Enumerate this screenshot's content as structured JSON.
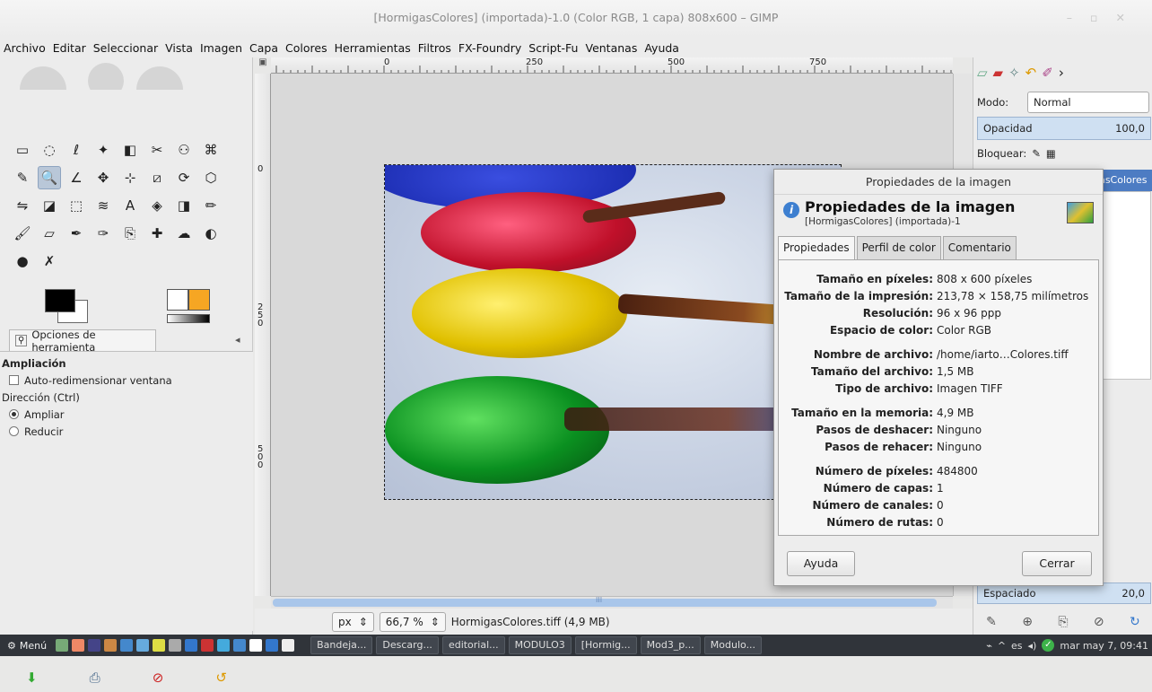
{
  "window": {
    "title": "[HormigasColores] (importada)-1.0 (Color RGB, 1 capa) 808x600 – GIMP"
  },
  "menubar": [
    "Archivo",
    "Editar",
    "Seleccionar",
    "Vista",
    "Imagen",
    "Capa",
    "Colores",
    "Herramientas",
    "Filtros",
    "FX-Foundry",
    "Script-Fu",
    "Ventanas",
    "Ayuda"
  ],
  "toolbox": {
    "tools": [
      "rect-select-icon",
      "ellipse-select-icon",
      "free-select-icon",
      "fuzzy-select-icon",
      "color-select-icon",
      "scissors-icon",
      "foreground-select-icon",
      "paths-icon",
      "color-picker-icon",
      "zoom-icon",
      "measure-icon",
      "move-icon",
      "align-icon",
      "crop-icon",
      "transform-icon",
      "cage-icon",
      "flip-icon",
      "perspective-icon",
      "unified-transform-icon",
      "warp-icon",
      "text-icon",
      "bucket-fill-icon",
      "blend-icon",
      "pencil-icon",
      "paintbrush-icon",
      "eraser-icon",
      "airbrush-icon",
      "ink-icon",
      "clone-icon",
      "heal-icon",
      "smudge-icon",
      "dodge-icon",
      "blur-icon",
      "pen-icon"
    ],
    "tool_glyphs": [
      "▭",
      "◌",
      "ℓ",
      "✦",
      "◧",
      "✂",
      "⚇",
      "⌘",
      "✎",
      "🔍",
      "∠",
      "✥",
      "⊹",
      "⧄",
      "⟳",
      "⬡",
      "⇋",
      "◪",
      "⬚",
      "≋",
      "A",
      "◈",
      "◨",
      "✏",
      "🖌",
      "▱",
      "✒",
      "✑",
      "⎘",
      "✚",
      "☁",
      "◐",
      "●",
      "✗"
    ],
    "options_tab": "Opciones de herramienta",
    "section_title": "Ampliación",
    "auto_resize": "Auto-redimensionar ventana",
    "direction_label": "Dirección (Ctrl)",
    "zoom_in": "Ampliar",
    "zoom_out": "Reducir"
  },
  "canvas": {
    "hruler_labels": [
      "0",
      "250",
      "500",
      "750"
    ],
    "vruler_labels": [
      "0",
      "250",
      "500"
    ],
    "unit": "px",
    "zoom": "66,7 %",
    "status": "HormigasColores.tiff (4,9 MB)",
    "scroll_mark": "III"
  },
  "dock": {
    "mode_label": "Modo:",
    "mode_value": "Normal",
    "opacity_label": "Opacidad",
    "opacity_value": "100,0",
    "lock_label": "Bloquear:",
    "layer_name": "HormigasColores",
    "spacing_label": "Espaciado",
    "spacing_value": "20,0"
  },
  "dialog": {
    "title": "Propiedades de la imagen",
    "heading": "Propiedades de la imagen",
    "subheading": "[HormigasColores] (importada)-1",
    "tabs": [
      "Propiedades",
      "Perfil de color",
      "Comentario"
    ],
    "props": [
      {
        "k": "Tamaño en píxeles:",
        "v": "808 x 600 píxeles"
      },
      {
        "k": "Tamaño de la impresión:",
        "v": "213,78 × 158,75 milímetros"
      },
      {
        "k": "Resolución:",
        "v": "96 x 96 ppp"
      },
      {
        "k": "Espacio de color:",
        "v": "Color RGB"
      },
      {
        "k": "Nombre de archivo:",
        "v": "/home/iarto…Colores.tiff"
      },
      {
        "k": "Tamaño del archivo:",
        "v": "1,5 MB"
      },
      {
        "k": "Tipo de archivo:",
        "v": "Imagen TIFF"
      },
      {
        "k": "Tamaño en la memoria:",
        "v": "4,9 MB"
      },
      {
        "k": "Pasos de deshacer:",
        "v": "Ninguno"
      },
      {
        "k": "Pasos de rehacer:",
        "v": "Ninguno"
      },
      {
        "k": "Número de píxeles:",
        "v": "484800"
      },
      {
        "k": "Número de capas:",
        "v": "1"
      },
      {
        "k": "Número de canales:",
        "v": "0"
      },
      {
        "k": "Número de rutas:",
        "v": "0"
      }
    ],
    "help_button": "Ayuda",
    "close_button": "Cerrar"
  },
  "taskbar": {
    "menu": "Menú",
    "tasks": [
      "Bandeja...",
      "Descarg...",
      "editorial...",
      "MODULO3",
      "[Hormig...",
      "Mod3_p...",
      "Modulo..."
    ],
    "layout": "es",
    "clock": "mar may 7, 09:41"
  }
}
